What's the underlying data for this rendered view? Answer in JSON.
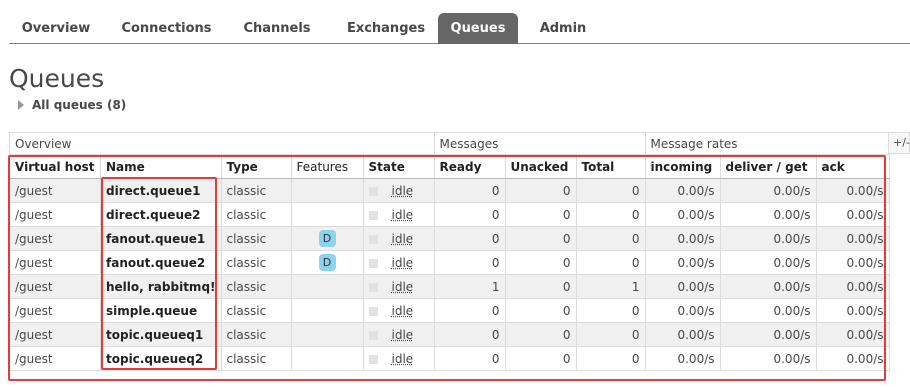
{
  "nav": {
    "tabs": [
      {
        "label": "Overview"
      },
      {
        "label": "Connections"
      },
      {
        "label": "Channels"
      },
      {
        "label": "Exchanges"
      },
      {
        "label": "Queues"
      },
      {
        "label": "Admin"
      }
    ]
  },
  "page": {
    "title": "Queues",
    "all_queues_label": "All queues (8)"
  },
  "table": {
    "group_headers": [
      "Overview",
      "Messages",
      "Message rates"
    ],
    "plus_minus": "+/-",
    "columns": [
      "Virtual host",
      "Name",
      "Type",
      "Features",
      "State",
      "Ready",
      "Unacked",
      "Total",
      "incoming",
      "deliver / get",
      "ack"
    ],
    "rows": [
      {
        "vhost": "/guest",
        "name": "direct.queue1",
        "type": "classic",
        "feature": "",
        "state": "idle",
        "ready": "0",
        "unacked": "0",
        "total": "0",
        "incoming": "0.00/s",
        "deliver": "0.00/s",
        "ack": "0.00/s"
      },
      {
        "vhost": "/guest",
        "name": "direct.queue2",
        "type": "classic",
        "feature": "",
        "state": "idle",
        "ready": "0",
        "unacked": "0",
        "total": "0",
        "incoming": "0.00/s",
        "deliver": "0.00/s",
        "ack": "0.00/s"
      },
      {
        "vhost": "/guest",
        "name": "fanout.queue1",
        "type": "classic",
        "feature": "D",
        "state": "idle",
        "ready": "0",
        "unacked": "0",
        "total": "0",
        "incoming": "0.00/s",
        "deliver": "0.00/s",
        "ack": "0.00/s"
      },
      {
        "vhost": "/guest",
        "name": "fanout.queue2",
        "type": "classic",
        "feature": "D",
        "state": "idle",
        "ready": "0",
        "unacked": "0",
        "total": "0",
        "incoming": "0.00/s",
        "deliver": "0.00/s",
        "ack": "0.00/s"
      },
      {
        "vhost": "/guest",
        "name": "hello, rabbitmq!",
        "type": "classic",
        "feature": "",
        "state": "idle",
        "ready": "1",
        "unacked": "0",
        "total": "1",
        "incoming": "0.00/s",
        "deliver": "0.00/s",
        "ack": "0.00/s"
      },
      {
        "vhost": "/guest",
        "name": "simple.queue",
        "type": "classic",
        "feature": "",
        "state": "idle",
        "ready": "0",
        "unacked": "0",
        "total": "0",
        "incoming": "0.00/s",
        "deliver": "0.00/s",
        "ack": "0.00/s"
      },
      {
        "vhost": "/guest",
        "name": "topic.queueq1",
        "type": "classic",
        "feature": "",
        "state": "idle",
        "ready": "0",
        "unacked": "0",
        "total": "0",
        "incoming": "0.00/s",
        "deliver": "0.00/s",
        "ack": "0.00/s"
      },
      {
        "vhost": "/guest",
        "name": "topic.queueq2",
        "type": "classic",
        "feature": "",
        "state": "idle",
        "ready": "0",
        "unacked": "0",
        "total": "0",
        "incoming": "0.00/s",
        "deliver": "0.00/s",
        "ack": "0.00/s"
      }
    ]
  },
  "colors": {
    "active_tab": "#666666",
    "feature_badge": "#8cd3ef",
    "highlight": "#e23b3b"
  }
}
